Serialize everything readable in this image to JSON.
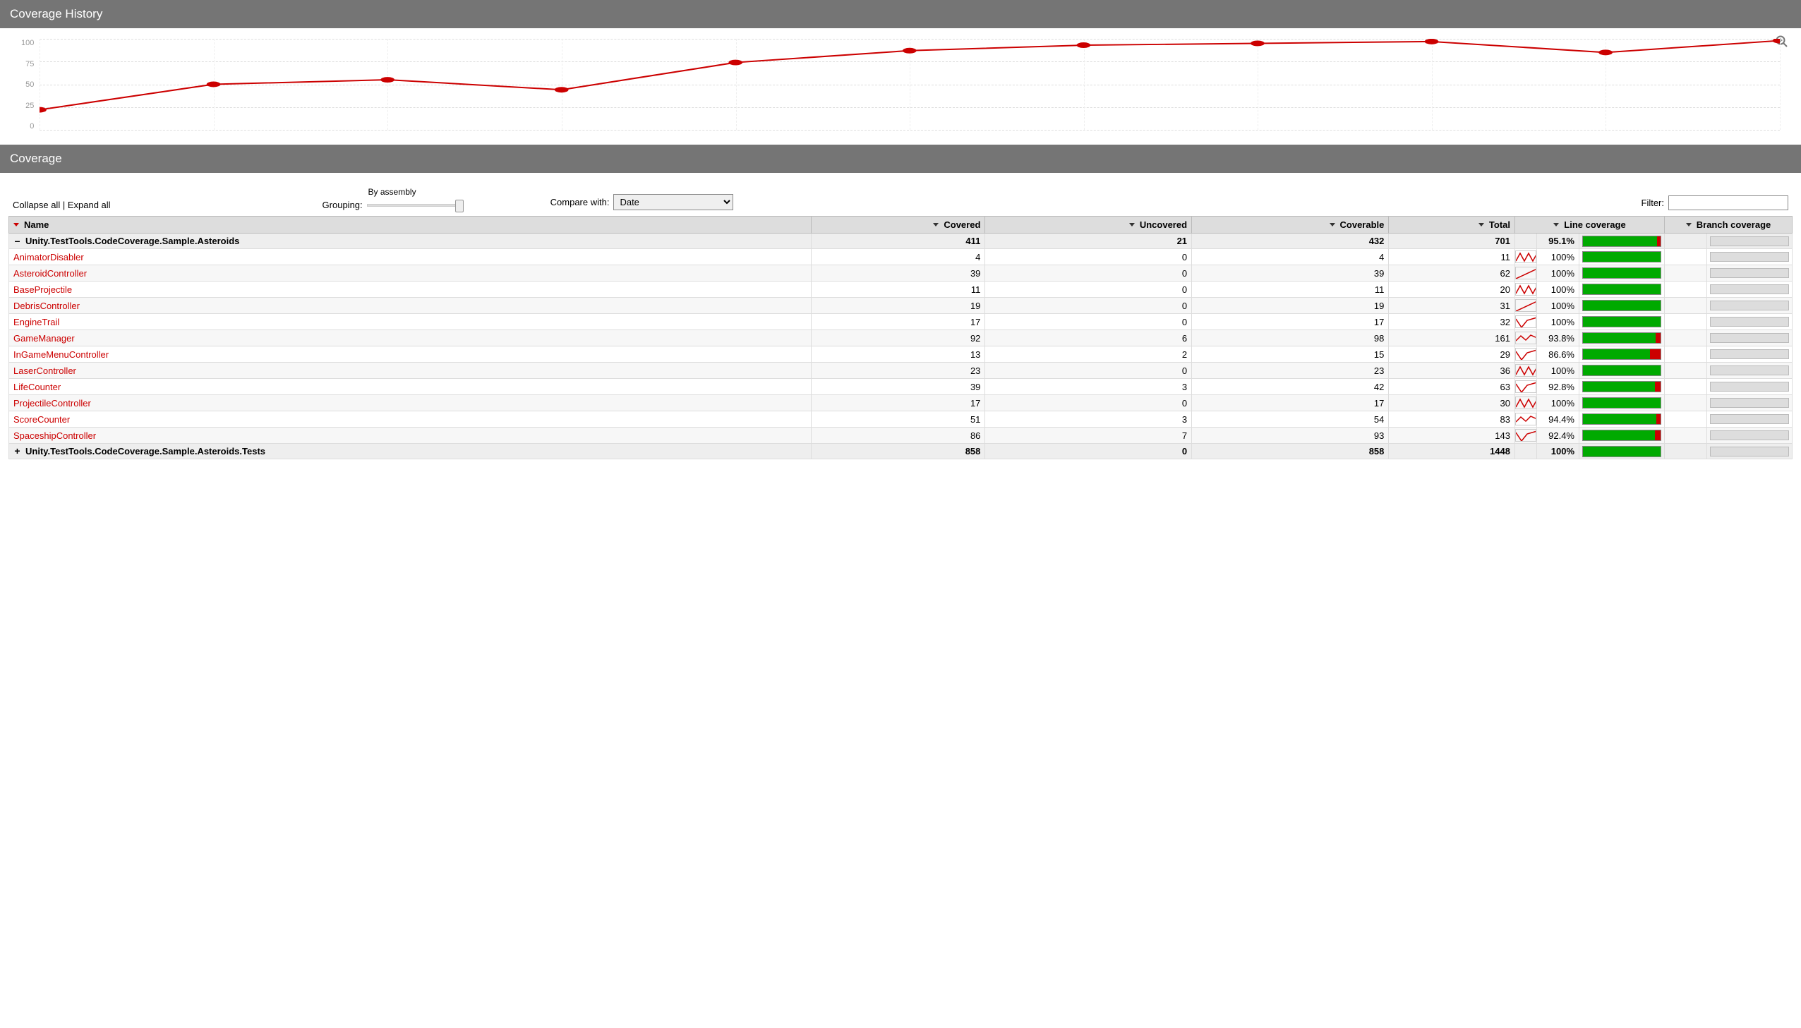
{
  "history": {
    "title": "Coverage History",
    "y_ticks": [
      "100",
      "75",
      "50",
      "25",
      "0"
    ]
  },
  "chart_data": {
    "type": "line",
    "title": "Coverage History",
    "ylabel": "",
    "xlabel": "",
    "ylim": [
      0,
      100
    ],
    "x": [
      0,
      1,
      2,
      3,
      4,
      5,
      6,
      7,
      8,
      9,
      10
    ],
    "values": [
      22,
      50,
      55,
      44,
      74,
      87,
      93,
      95,
      97,
      85,
      98
    ]
  },
  "coverage": {
    "title": "Coverage"
  },
  "controls": {
    "collapse_all": "Collapse all",
    "expand_all": "Expand all",
    "grouping_label": "Grouping:",
    "grouping_value": "By assembly",
    "compare_label": "Compare with:",
    "compare_option": "Date",
    "filter_label": "Filter:"
  },
  "table": {
    "headers": {
      "name": "Name",
      "covered": "Covered",
      "uncovered": "Uncovered",
      "coverable": "Coverable",
      "total": "Total",
      "line_coverage": "Line coverage",
      "branch_coverage": "Branch coverage"
    },
    "rows": [
      {
        "kind": "assembly",
        "expand": "–",
        "name": "Unity.TestTools.CodeCoverage.Sample.Asteroids",
        "covered": "411",
        "uncovered": "21",
        "coverable": "432",
        "total": "701",
        "pct": "95.1%",
        "pct_num": 95.1,
        "spark": null
      },
      {
        "kind": "class",
        "name": "AnimatorDisabler",
        "covered": "4",
        "uncovered": "0",
        "coverable": "4",
        "total": "11",
        "pct": "100%",
        "pct_num": 100,
        "spark": "zigzag"
      },
      {
        "kind": "class",
        "name": "AsteroidController",
        "covered": "39",
        "uncovered": "0",
        "coverable": "39",
        "total": "62",
        "pct": "100%",
        "pct_num": 100,
        "spark": "up"
      },
      {
        "kind": "class",
        "name": "BaseProjectile",
        "covered": "11",
        "uncovered": "0",
        "coverable": "11",
        "total": "20",
        "pct": "100%",
        "pct_num": 100,
        "spark": "zigzag"
      },
      {
        "kind": "class",
        "name": "DebrisController",
        "covered": "19",
        "uncovered": "0",
        "coverable": "19",
        "total": "31",
        "pct": "100%",
        "pct_num": 100,
        "spark": "up"
      },
      {
        "kind": "class",
        "name": "EngineTrail",
        "covered": "17",
        "uncovered": "0",
        "coverable": "17",
        "total": "32",
        "pct": "100%",
        "pct_num": 100,
        "spark": "dipup"
      },
      {
        "kind": "class",
        "name": "GameManager",
        "covered": "92",
        "uncovered": "6",
        "coverable": "98",
        "total": "161",
        "pct": "93.8%",
        "pct_num": 93.8,
        "spark": "wavy"
      },
      {
        "kind": "class",
        "name": "InGameMenuController",
        "covered": "13",
        "uncovered": "2",
        "coverable": "15",
        "total": "29",
        "pct": "86.6%",
        "pct_num": 86.6,
        "spark": "dipup"
      },
      {
        "kind": "class",
        "name": "LaserController",
        "covered": "23",
        "uncovered": "0",
        "coverable": "23",
        "total": "36",
        "pct": "100%",
        "pct_num": 100,
        "spark": "zigzag"
      },
      {
        "kind": "class",
        "name": "LifeCounter",
        "covered": "39",
        "uncovered": "3",
        "coverable": "42",
        "total": "63",
        "pct": "92.8%",
        "pct_num": 92.8,
        "spark": "dipup"
      },
      {
        "kind": "class",
        "name": "ProjectileController",
        "covered": "17",
        "uncovered": "0",
        "coverable": "17",
        "total": "30",
        "pct": "100%",
        "pct_num": 100,
        "spark": "zigzag"
      },
      {
        "kind": "class",
        "name": "ScoreCounter",
        "covered": "51",
        "uncovered": "3",
        "coverable": "54",
        "total": "83",
        "pct": "94.4%",
        "pct_num": 94.4,
        "spark": "wavy"
      },
      {
        "kind": "class",
        "name": "SpaceshipController",
        "covered": "86",
        "uncovered": "7",
        "coverable": "93",
        "total": "143",
        "pct": "92.4%",
        "pct_num": 92.4,
        "spark": "dipup"
      },
      {
        "kind": "assembly",
        "expand": "+",
        "name": "Unity.TestTools.CodeCoverage.Sample.Asteroids.Tests",
        "covered": "858",
        "uncovered": "0",
        "coverable": "858",
        "total": "1448",
        "pct": "100%",
        "pct_num": 100,
        "spark": null
      }
    ]
  }
}
